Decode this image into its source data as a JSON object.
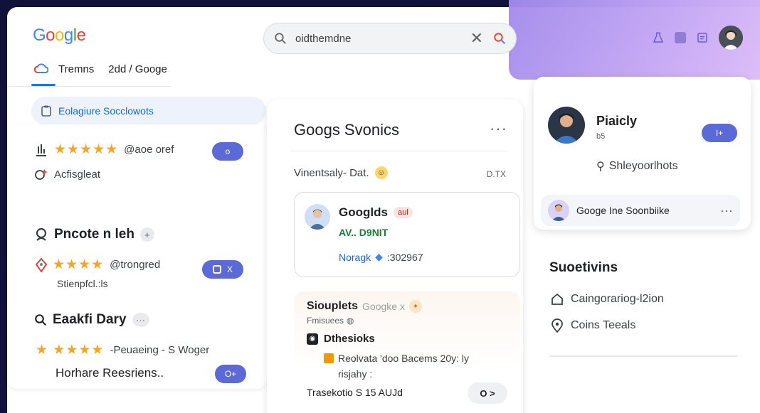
{
  "header": {
    "logo": [
      "G",
      "o",
      "o",
      "g",
      "l",
      "e"
    ],
    "logo_colors": [
      "#4285f4",
      "#ea4335",
      "#fbbc05",
      "#4285f4",
      "#34a853",
      "#ea4335"
    ],
    "search_value": "oidthemdne"
  },
  "tabs": {
    "tab1": "Tremns",
    "tab2": "2dd / Googe"
  },
  "pill": {
    "label": "Eolagiure  Socclowots"
  },
  "left": {
    "row1_text": "@aoe oref",
    "row1_toggle": "o",
    "row2_text": "Acfisgleat",
    "heading1": "Pncote n leh",
    "heading1_chip": "+",
    "row3_text": "@trongred",
    "row3_toggle": "X",
    "row3_sub": "Stienpfcl.:ls",
    "heading2": "Eaakfi Dary",
    "heading2_chip": "···",
    "row4_text": "-Peuaeing - S Woger",
    "row5_text": "Horhare Reesriens..",
    "row5_toggle": "O+"
  },
  "center": {
    "title": "Googs Svonics",
    "dots": "···",
    "subtitle": "Vinentsaly- Dat.",
    "subtitle_right": "D.TX",
    "card1_name": "Googlds",
    "card1_badge": "aul",
    "card1_line2": "AV.. D9NIT",
    "card1_line3a": "Noragk",
    "card1_line3b": ":302967",
    "card2_title": "Siouplets",
    "card2_title_b": "Googke x",
    "card2_sub": "Fmisuees",
    "card2_h": "Dthesioks",
    "card2_line1": "Reolvata 'doo Bacems 20y: ly",
    "card2_line2": "risjahy :",
    "card2_line3": "Trasekotio  S 15 AUJd",
    "card2_btn": "O >"
  },
  "right": {
    "name": "Piaicly",
    "sub": "b5",
    "toggle": "I+",
    "row": "Shleyoorlhots",
    "subcard_text": "Googe Ine Soonbiike",
    "subcard_dots": "···"
  },
  "suggestions": {
    "title": "Suoetivins",
    "item1": "Caingorariog-l2ion",
    "item2": "Coins Teeals"
  },
  "colors": {
    "accent": "#5b6ad6",
    "star": "#f6a622",
    "link": "#1967d2"
  }
}
